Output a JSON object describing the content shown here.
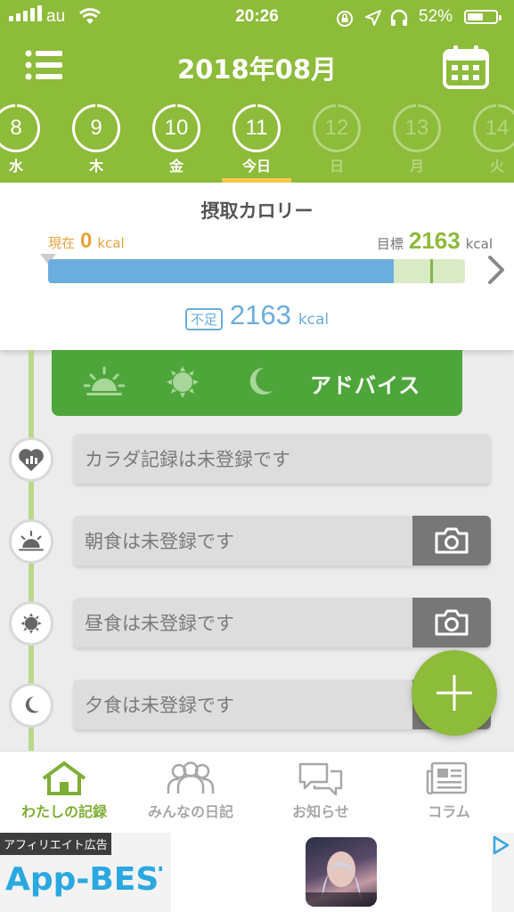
{
  "status_bar": {
    "carrier": "au",
    "time": "20:26",
    "battery": "52%",
    "battery_level": 0.52,
    "icons": [
      "signal-icon",
      "wifi-icon",
      "rotation-lock-icon",
      "location-arrow-icon",
      "headphones-icon",
      "battery-icon"
    ]
  },
  "header": {
    "month": "2018年08月",
    "menu_icon": "list-menu-icon",
    "calendar_icon": "calendar-icon"
  },
  "days": [
    {
      "num": "8",
      "week": "水",
      "state": "past"
    },
    {
      "num": "9",
      "week": "木",
      "state": "past"
    },
    {
      "num": "10",
      "week": "金",
      "state": "past"
    },
    {
      "num": "11",
      "week": "今日",
      "state": "today"
    },
    {
      "num": "12",
      "week": "日",
      "state": "future"
    },
    {
      "num": "13",
      "week": "月",
      "state": "future"
    },
    {
      "num": "14",
      "week": "火",
      "state": "future"
    }
  ],
  "calorie": {
    "title": "摂取カロリー",
    "current_label": "現在",
    "current_value": "0",
    "unit": "kcal",
    "goal_label": "目標",
    "goal_value": "2163",
    "progress_fraction": 0.83,
    "shortage_label": "不足",
    "shortage_value": "2163"
  },
  "advice": {
    "label": "アドバイス",
    "icons": [
      "sunrise-icon",
      "sun-icon",
      "moon-icon"
    ]
  },
  "entries": {
    "body": "カラダ記録は未登録です",
    "breakfast": "朝食は未登録です",
    "lunch": "昼食は未登録です",
    "dinner": "夕食は未登録です"
  },
  "tabs": [
    {
      "label": "わたしの記録",
      "icon": "home-icon",
      "active": true
    },
    {
      "label": "みんなの日記",
      "icon": "people-icon",
      "active": false
    },
    {
      "label": "お知らせ",
      "icon": "chat-bubbles-icon",
      "active": false
    },
    {
      "label": "コラム",
      "icon": "newspaper-icon",
      "active": false
    }
  ],
  "ad": {
    "tag": "アフィリエイト広告",
    "logo": "App-BEST"
  },
  "colors": {
    "header_green": "#8dbb3a",
    "advice_green": "#4ea63b",
    "bar_blue": "#6badde",
    "current_orange": "#e9a23b",
    "today_yellow": "#f7c948"
  }
}
